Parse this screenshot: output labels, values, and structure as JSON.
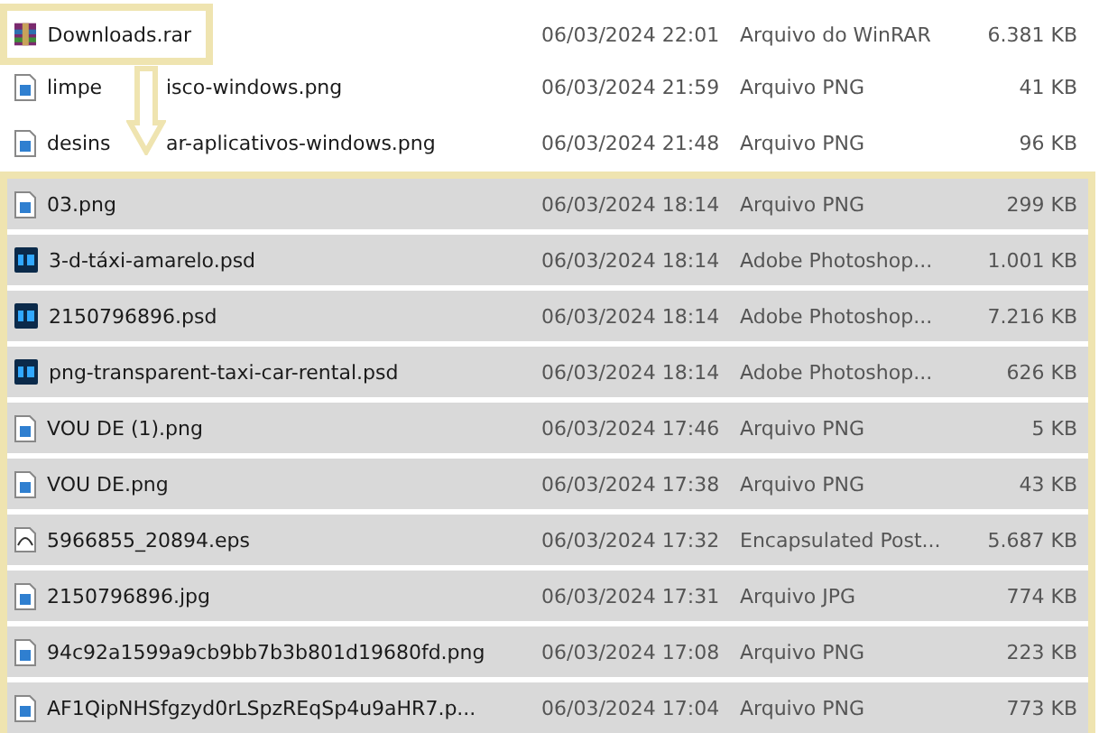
{
  "files": [
    {
      "name": "Downloads.rar",
      "date": "06/03/2024 22:01",
      "type": "Arquivo do WinRAR",
      "size": "6.381 KB",
      "kind": "rar",
      "selected": false,
      "highlighted": true
    },
    {
      "name_parts": [
        "limpe",
        "isco-windows.png"
      ],
      "date": "06/03/2024 21:59",
      "type": "Arquivo PNG",
      "size": "41 KB",
      "kind": "image",
      "selected": false,
      "highlighted": false
    },
    {
      "name_parts": [
        "desins",
        "ar-aplicativos-windows.png"
      ],
      "date": "06/03/2024 21:48",
      "type": "Arquivo PNG",
      "size": "96 KB",
      "kind": "image",
      "selected": false,
      "highlighted": false
    },
    {
      "name": "03.png",
      "date": "06/03/2024 18:14",
      "type": "Arquivo PNG",
      "size": "299 KB",
      "kind": "image",
      "selected": true,
      "highlighted": false
    },
    {
      "name": "3-d-táxi-amarelo.psd",
      "date": "06/03/2024 18:14",
      "type": "Adobe Photoshop...",
      "size": "1.001 KB",
      "kind": "psd",
      "selected": true,
      "highlighted": false
    },
    {
      "name": "2150796896.psd",
      "date": "06/03/2024 18:14",
      "type": "Adobe Photoshop...",
      "size": "7.216 KB",
      "kind": "psd",
      "selected": true,
      "highlighted": false
    },
    {
      "name": "png-transparent-taxi-car-rental.psd",
      "date": "06/03/2024 18:14",
      "type": "Adobe Photoshop...",
      "size": "626 KB",
      "kind": "psd",
      "selected": true,
      "highlighted": false
    },
    {
      "name": "VOU DE (1).png",
      "date": "06/03/2024 17:46",
      "type": "Arquivo PNG",
      "size": "5 KB",
      "kind": "image",
      "selected": true,
      "highlighted": false
    },
    {
      "name": "VOU DE.png",
      "date": "06/03/2024 17:38",
      "type": "Arquivo PNG",
      "size": "43 KB",
      "kind": "image",
      "selected": true,
      "highlighted": false
    },
    {
      "name": "5966855_20894.eps",
      "date": "06/03/2024 17:32",
      "type": "Encapsulated Post...",
      "size": "5.687 KB",
      "kind": "eps",
      "selected": true,
      "highlighted": false
    },
    {
      "name": "2150796896.jpg",
      "date": "06/03/2024 17:31",
      "type": "Arquivo JPG",
      "size": "774 KB",
      "kind": "image",
      "selected": true,
      "highlighted": false
    },
    {
      "name": "94c92a1599a9cb9bb7b3b801d19680fd.png",
      "date": "06/03/2024 17:08",
      "type": "Arquivo PNG",
      "size": "223 KB",
      "kind": "image",
      "selected": true,
      "highlighted": false
    },
    {
      "name": "AF1QipNHSfgzyd0rLSpzREqSp4u9aHR7.p...",
      "date": "06/03/2024 17:04",
      "type": "Arquivo PNG",
      "size": "773 KB",
      "kind": "image",
      "selected": true,
      "highlighted": false
    }
  ]
}
